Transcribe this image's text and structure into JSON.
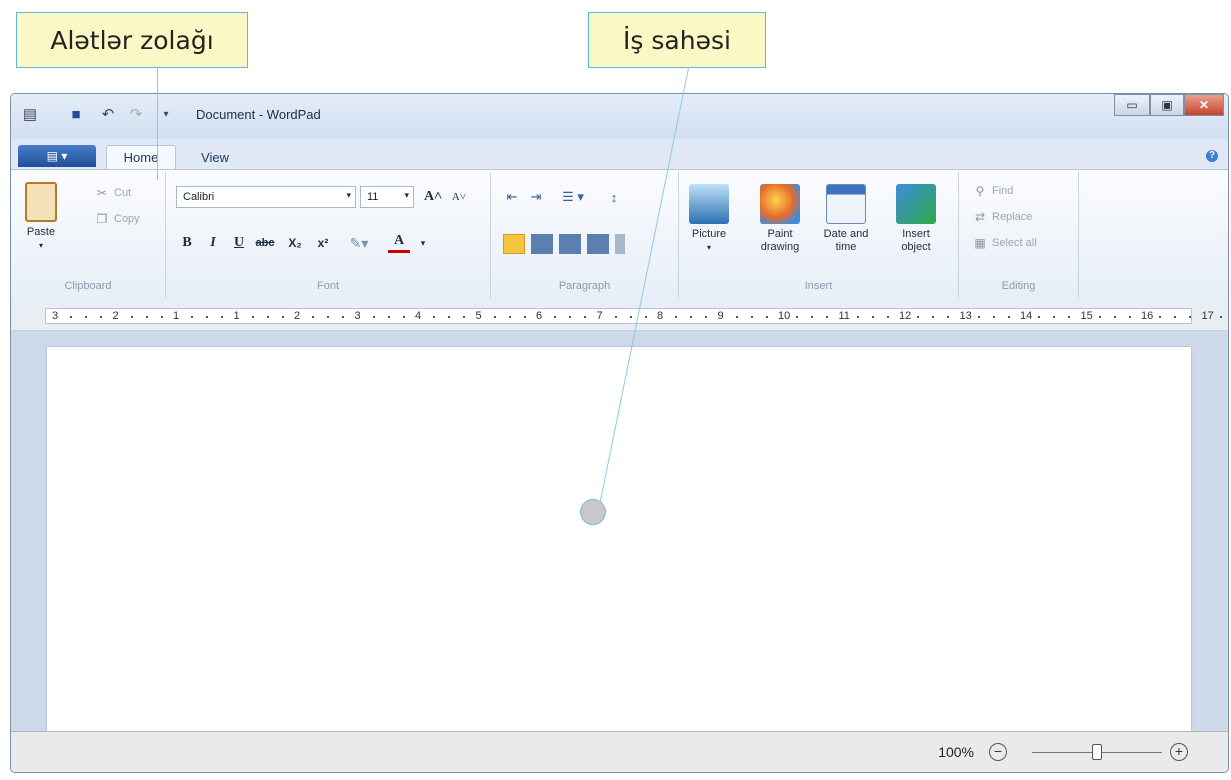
{
  "callouts": {
    "toolbar": "Alətlər zolağı",
    "workspace": "İş sahəsi"
  },
  "window": {
    "title": "Document - WordPad"
  },
  "tabs": [
    "Home",
    "View"
  ],
  "clipboard": {
    "paste": "Paste",
    "cut": "Cut",
    "copy": "Copy",
    "label": "Clipboard"
  },
  "font": {
    "name": "Calibri",
    "size": "11",
    "label": "Font",
    "bold": "B",
    "italic": "I",
    "underline": "U",
    "strike": "abc",
    "subscript": "X₂",
    "superscript": "x²"
  },
  "paragraph": {
    "label": "Paragraph"
  },
  "insert": {
    "picture": "Picture",
    "paint": "Paint drawing",
    "datetime": "Date and time",
    "object": "Insert object",
    "label": "Insert"
  },
  "editing": {
    "find": "Find",
    "replace": "Replace",
    "select_all": "Select all",
    "label": "Editing"
  },
  "ruler": {
    "labels": [
      "3",
      "2",
      "1",
      "1",
      "2",
      "3",
      "4",
      "5",
      "6",
      "7",
      "8",
      "9",
      "10",
      "11",
      "12",
      "13",
      "14",
      "15",
      "16",
      "17"
    ]
  },
  "status": {
    "zoom": "100%"
  },
  "zoom_level": 100,
  "colors": {
    "callout_bg": "#fcf8c6",
    "callout_border": "#5fb6e0",
    "accent": "#2b5aa6"
  },
  "icons": [
    "wordpad-icon",
    "save-icon",
    "undo-icon",
    "redo-icon",
    "customize-icon",
    "cut-icon",
    "copy-icon",
    "paste-icon",
    "grow-font-icon",
    "shrink-font-icon",
    "indent-icon",
    "outdent-icon",
    "bullets-icon",
    "line-spacing-icon",
    "align-left-icon",
    "align-center-icon",
    "align-right-icon",
    "justify-icon",
    "picture-icon",
    "paint-icon",
    "calendar-icon",
    "object-icon",
    "find-icon",
    "replace-icon",
    "select-all-icon",
    "zoom-out-icon",
    "zoom-in-icon",
    "help-icon"
  ]
}
